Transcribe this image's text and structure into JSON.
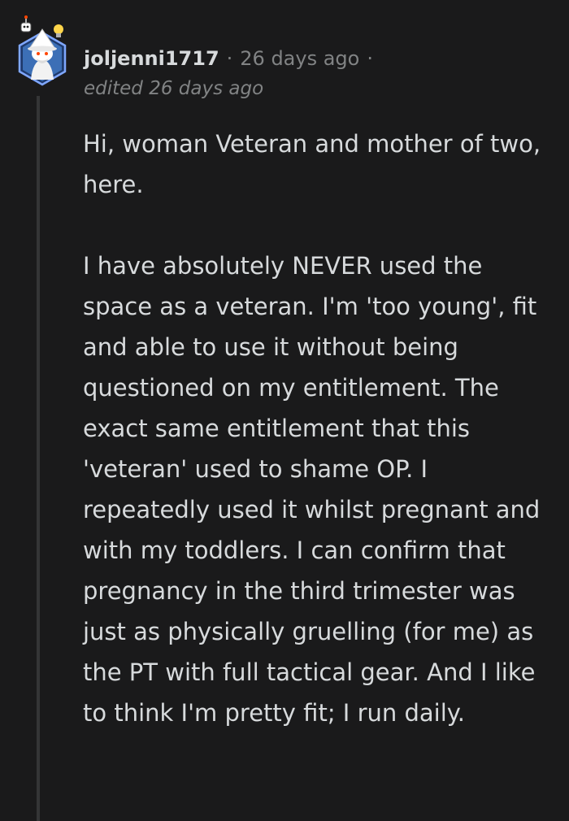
{
  "comment": {
    "author": "joljenni1717",
    "separator": "·",
    "timestamp": "26 days ago",
    "edited": "edited 26 days ago",
    "paragraphs": [
      "Hi, woman Veteran and mother of two, here.",
      "I have absolutely NEVER used the space as a veteran. I'm 'too young', fit and able to use it without being questioned on my entitlement. The exact same entitlement that this 'veteran' used to shame OP. I repeatedly used it whilst pregnant and with my toddlers. I can confirm that pregnancy in the third trimester was just as physically gruelling (for me) as the PT with full tactical gear. And I like to think I'm pretty fit; I run daily."
    ]
  },
  "colors": {
    "background": "#1a1a1b",
    "text": "#d7dadc",
    "meta": "#818384",
    "thread_line": "#343536",
    "avatar_ring": "#7fa7ff"
  },
  "icons": {
    "avatar": "snoo-wizard-avatar-icon",
    "avatar_accessory_left": "robot-pin-icon",
    "avatar_accessory_right": "light-bulb-icon"
  }
}
